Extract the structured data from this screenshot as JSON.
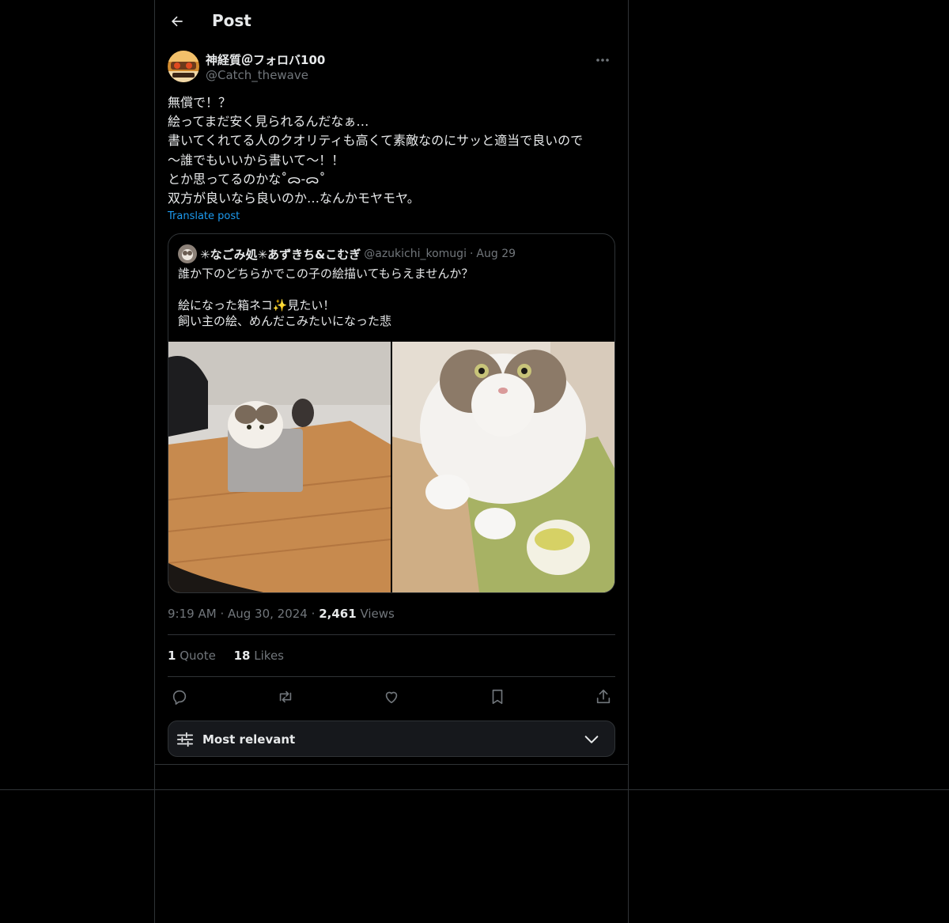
{
  "header": {
    "title": "Post"
  },
  "author": {
    "name": "神経質＠フォロバ100",
    "handle": "@Catch_thewave"
  },
  "post": {
    "text": "無償で！？\n絵ってまだ安く見られるんだなぁ…\n書いてくれてる人のクオリティも高くて素敵なのにサッと適当で良いので\n〜誰でもいいから書いて〜！！\nとか思ってるのかな˚ᯅ-ᯅ˚\n双方が良いなら良いのか…なんかモヤモヤ。",
    "translate_label": "Translate post"
  },
  "quoted": {
    "name": "✳︎なごみ処✳︎あずきち&こむぎ",
    "handle": "@azukichi_komugi",
    "separator": "·",
    "date": "Aug 29",
    "text": "誰か下のどちらかでこの子の絵描いてもらえませんか？\n\n絵になった箱ネコ✨見たい！\n飼い主の絵、めんだこみたいになった悲"
  },
  "meta": {
    "time": "9:19 AM",
    "separator": "·",
    "date": "Aug 30, 2024",
    "views_count": "2,461",
    "views_label": "Views"
  },
  "stats": {
    "quote_count": "1",
    "quote_label": "Quote",
    "likes_count": "18",
    "likes_label": "Likes"
  },
  "sort": {
    "label": "Most relevant"
  },
  "icons": {
    "back": "arrow-left-icon",
    "more": "more-dots-icon",
    "reply": "reply-icon",
    "repost": "repost-icon",
    "like": "heart-icon",
    "bookmark": "bookmark-icon",
    "share": "share-icon",
    "sort": "sliders-icon",
    "chevron": "chevron-down-icon"
  },
  "colors": {
    "background": "#000000",
    "text": "#e7e9ea",
    "muted": "#71767b",
    "link": "#1d9bf0",
    "border": "#2f3336"
  }
}
